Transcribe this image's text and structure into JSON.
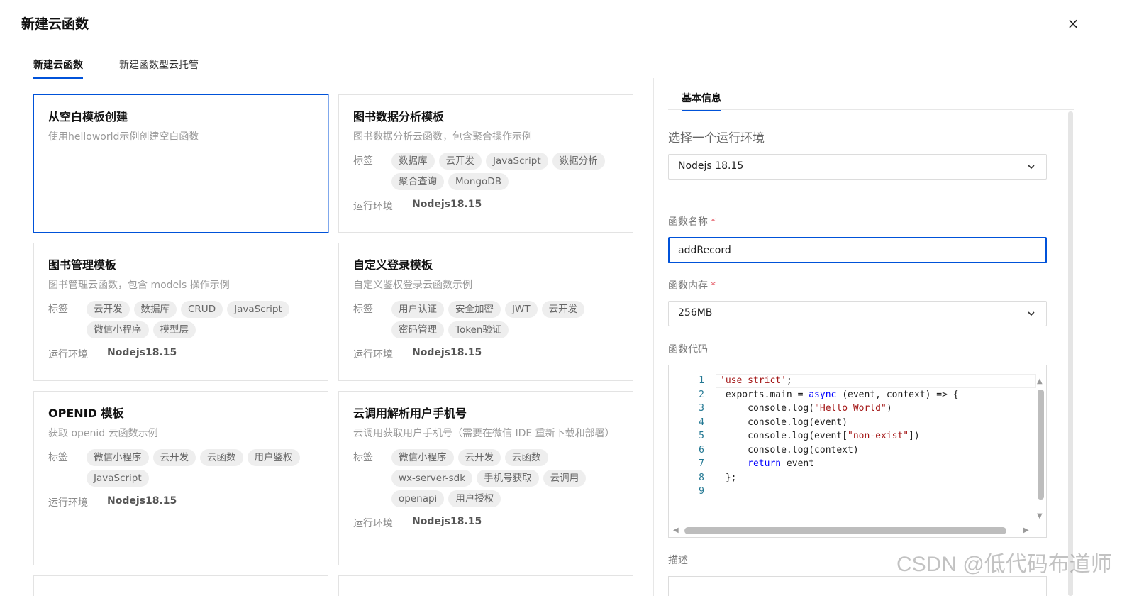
{
  "dialog": {
    "title": "新建云函数",
    "close_label": "×"
  },
  "tabs": [
    {
      "label": "新建云函数",
      "active": true
    },
    {
      "label": "新建函数型云托管",
      "active": false
    }
  ],
  "labels": {
    "tags": "标签",
    "env": "运行环境"
  },
  "cards": [
    {
      "title": "从空白模板创建",
      "desc": "使用helloworld示例创建空白函数",
      "selected": true
    },
    {
      "title": "图书数据分析模板",
      "desc": "图书数据分析云函数，包含聚合操作示例",
      "tags": [
        "数据库",
        "云开发",
        "JavaScript",
        "数据分析",
        "聚合查询",
        "MongoDB"
      ],
      "env": "Nodejs18.15"
    },
    {
      "title": "图书管理模板",
      "desc": "图书管理云函数，包含 models 操作示例",
      "tags": [
        "云开发",
        "数据库",
        "CRUD",
        "JavaScript",
        "微信小程序",
        "模型层"
      ],
      "env": "Nodejs18.15"
    },
    {
      "title": "自定义登录模板",
      "desc": "自定义鉴权登录云函数示例",
      "tags": [
        "用户认证",
        "安全加密",
        "JWT",
        "云开发",
        "密码管理",
        "Token验证"
      ],
      "env": "Nodejs18.15"
    },
    {
      "title": "OPENID 模板",
      "desc": "获取 openid 云函数示例",
      "tags": [
        "微信小程序",
        "云开发",
        "云函数",
        "用户鉴权",
        "JavaScript"
      ],
      "env": "Nodejs18.15"
    },
    {
      "title": "云调用解析用户手机号",
      "desc": "云调用获取用户手机号（需要在微信 IDE 重新下载和部署）",
      "tags": [
        "微信小程序",
        "云开发",
        "云函数",
        "wx-server-sdk",
        "手机号获取",
        "云调用",
        "openapi",
        "用户授权"
      ],
      "env": "Nodejs18.15"
    }
  ],
  "panel": {
    "tab": "基本信息",
    "env_label": "选择一个运行环境",
    "env_value": "Nodejs 18.15",
    "name_label": "函数名称",
    "name_value": "addRecord",
    "memory_label": "函数内存",
    "memory_value": "256MB",
    "code_label": "函数代码",
    "desc_label": "描述",
    "required_mark": "*"
  },
  "code_lines": [
    "'use strict';",
    " exports.main = async (event, context) => {",
    "     console.log(\"Hello World\")",
    "     console.log(event)",
    "     console.log(event[\"non-exist\"])",
    "     console.log(context)",
    "     return event",
    " };",
    ""
  ],
  "watermark": "CSDN @低代码布道师",
  "colors": {
    "accent": "#0052d9",
    "required": "#e34d59",
    "string": "#a31515",
    "keyword": "#0000ff",
    "line_number": "#237893"
  },
  "icons": {
    "close": "close-icon",
    "dropdown": "chevron-down-icon"
  }
}
